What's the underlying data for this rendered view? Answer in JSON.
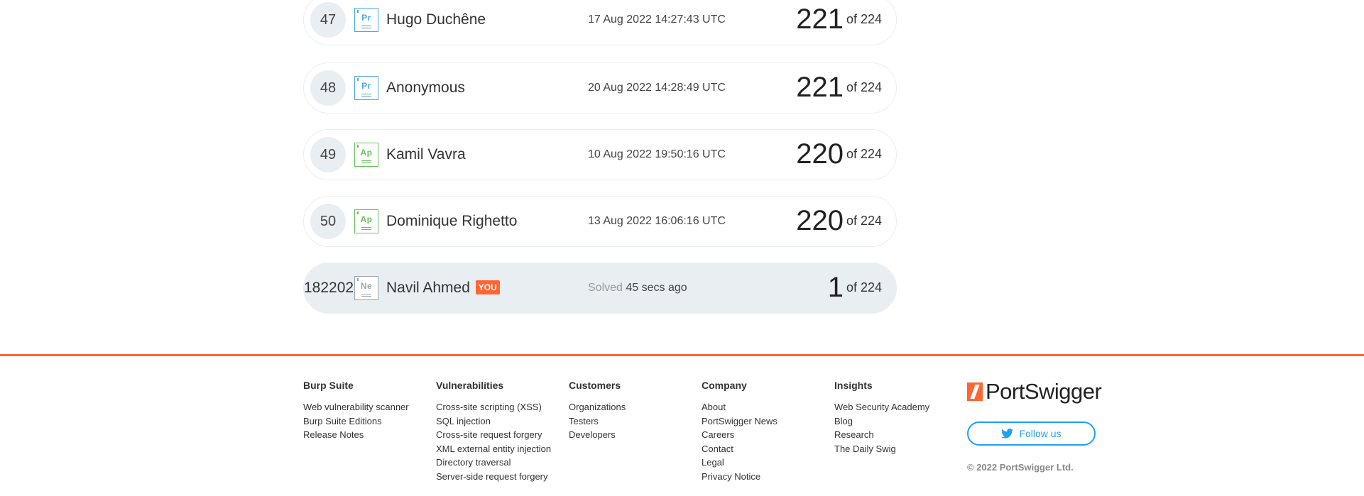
{
  "leaderboard": {
    "rows": [
      {
        "rank": "47",
        "badge": "Pr",
        "badge_color": "#4aa8de",
        "name": "Hugo Duchêne",
        "time": "17 Aug 2022 14:27:43 UTC",
        "score": "221",
        "of": "of 224"
      },
      {
        "rank": "48",
        "badge": "Pr",
        "badge_color": "#4aa8de",
        "name": "Anonymous",
        "time": "20 Aug 2022 14:28:49 UTC",
        "score": "221",
        "of": "of 224"
      },
      {
        "rank": "49",
        "badge": "Ap",
        "badge_color": "#66c25a",
        "name": "Kamil Vavra",
        "time": "10 Aug 2022 19:50:16 UTC",
        "score": "220",
        "of": "of 224"
      },
      {
        "rank": "50",
        "badge": "Ap",
        "badge_color": "#66c25a",
        "name": "Dominique Righetto",
        "time": "13 Aug 2022 16:06:16 UTC",
        "score": "220",
        "of": "of 224"
      }
    ],
    "current_user": {
      "rank": "182202",
      "badge": "Ne",
      "badge_color": "#9aa4ab",
      "name": "Navil Ahmed",
      "you_tag": "YOU",
      "solved_label": "Solved",
      "time": "45 secs ago",
      "score": "1",
      "of": "of 224"
    }
  },
  "footer": {
    "accent_color": "#ff6633",
    "columns": [
      {
        "title": "Burp Suite",
        "links": [
          "Web vulnerability scanner",
          "Burp Suite Editions",
          "Release Notes"
        ]
      },
      {
        "title": "Vulnerabilities",
        "links": [
          "Cross-site scripting (XSS)",
          "SQL injection",
          "Cross-site request forgery",
          "XML external entity injection",
          "Directory traversal",
          "Server-side request forgery"
        ]
      },
      {
        "title": "Customers",
        "links": [
          "Organizations",
          "Testers",
          "Developers"
        ]
      },
      {
        "title": "Company",
        "links": [
          "About",
          "PortSwigger News",
          "Careers",
          "Contact",
          "Legal",
          "Privacy Notice"
        ]
      },
      {
        "title": "Insights",
        "links": [
          "Web Security Academy",
          "Blog",
          "Research",
          "The Daily Swig"
        ]
      }
    ],
    "brand": "PortSwigger",
    "follow_label": "Follow us",
    "copyright": "© 2022 PortSwigger Ltd."
  }
}
